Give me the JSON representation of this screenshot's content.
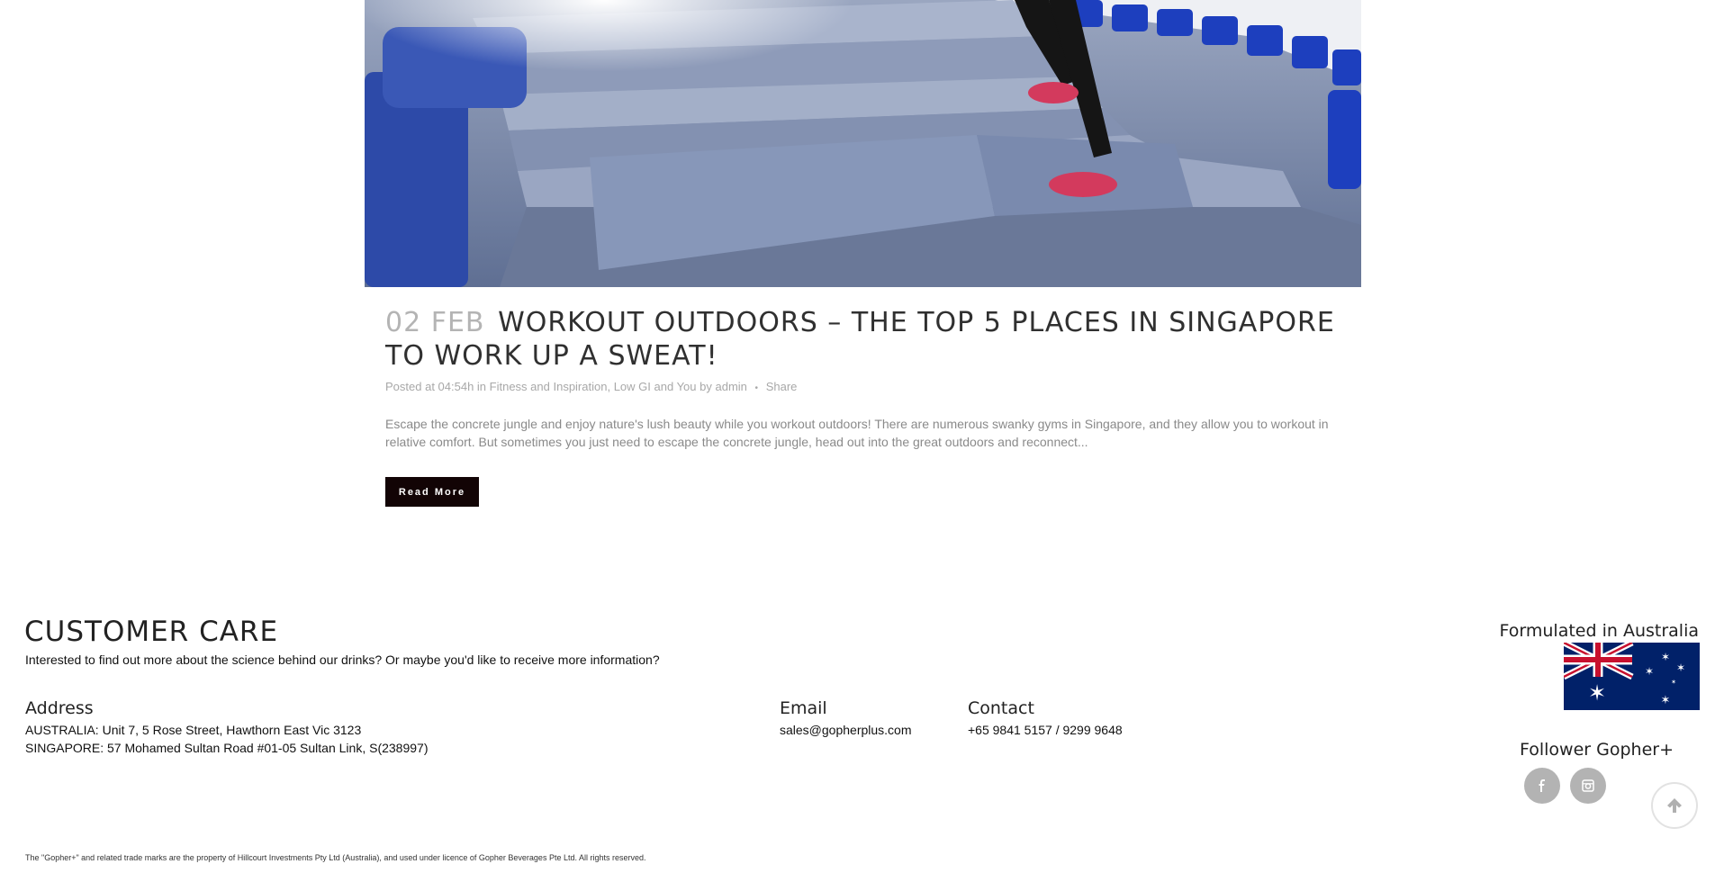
{
  "hero": {
    "alt": "Runner climbing stadium steps"
  },
  "post": {
    "date": "02 FEB",
    "title": "WORKOUT OUTDOORS – THE TOP 5 PLACES IN SINGAPORE TO WORK UP A SWEAT!",
    "meta": {
      "posted_prefix": "Posted at 04:54h in",
      "category_1": "Fitness and Inspiration",
      "comma": ",",
      "category_2": "Low GI and You",
      "by": "by",
      "author": "admin",
      "separator": "•",
      "share": "Share"
    },
    "excerpt": "Escape the concrete jungle and enjoy nature's lush beauty while you workout outdoors! There are numerous swanky gyms in Singapore, and they allow you to workout in relative comfort. But sometimes you just need to escape the concrete jungle, head out into the great outdoors and reconnect...",
    "read_more": "Read More"
  },
  "footer": {
    "title": "CUSTOMER CARE",
    "subtitle": "Interested to find out more about the science behind our drinks? Or maybe you'd like to receive more information?",
    "address": {
      "heading": "Address",
      "line1": "AUSTRALIA: Unit 7, 5 Rose Street, Hawthorn East Vic 3123",
      "line2": "SINGAPORE: 57 Mohamed Sultan Road #01-05 Sultan Link, S(238997)"
    },
    "email": {
      "heading": "Email",
      "value": "sales@gopherplus.com"
    },
    "contact": {
      "heading": "Contact",
      "value": "+65 9841 5157 / 9299 9648"
    },
    "formulated": "Formulated in Australia",
    "follower": "Follower Gopher+",
    "social": [
      {
        "icon": "facebook-icon"
      },
      {
        "icon": "instagram-icon"
      }
    ],
    "legal": "The \"Gopher+\" and related trade marks are the property of Hillcourt Investments Pty Ltd (Australia), and used under licence of Gopher Beverages Pte Ltd. All rights reserved."
  },
  "colors": {
    "button_bg": "#120405",
    "meta_text": "#a8a8a8",
    "social_bg": "#b3b3b3",
    "flag_blue": "#012169",
    "flag_red": "#c8102e"
  }
}
